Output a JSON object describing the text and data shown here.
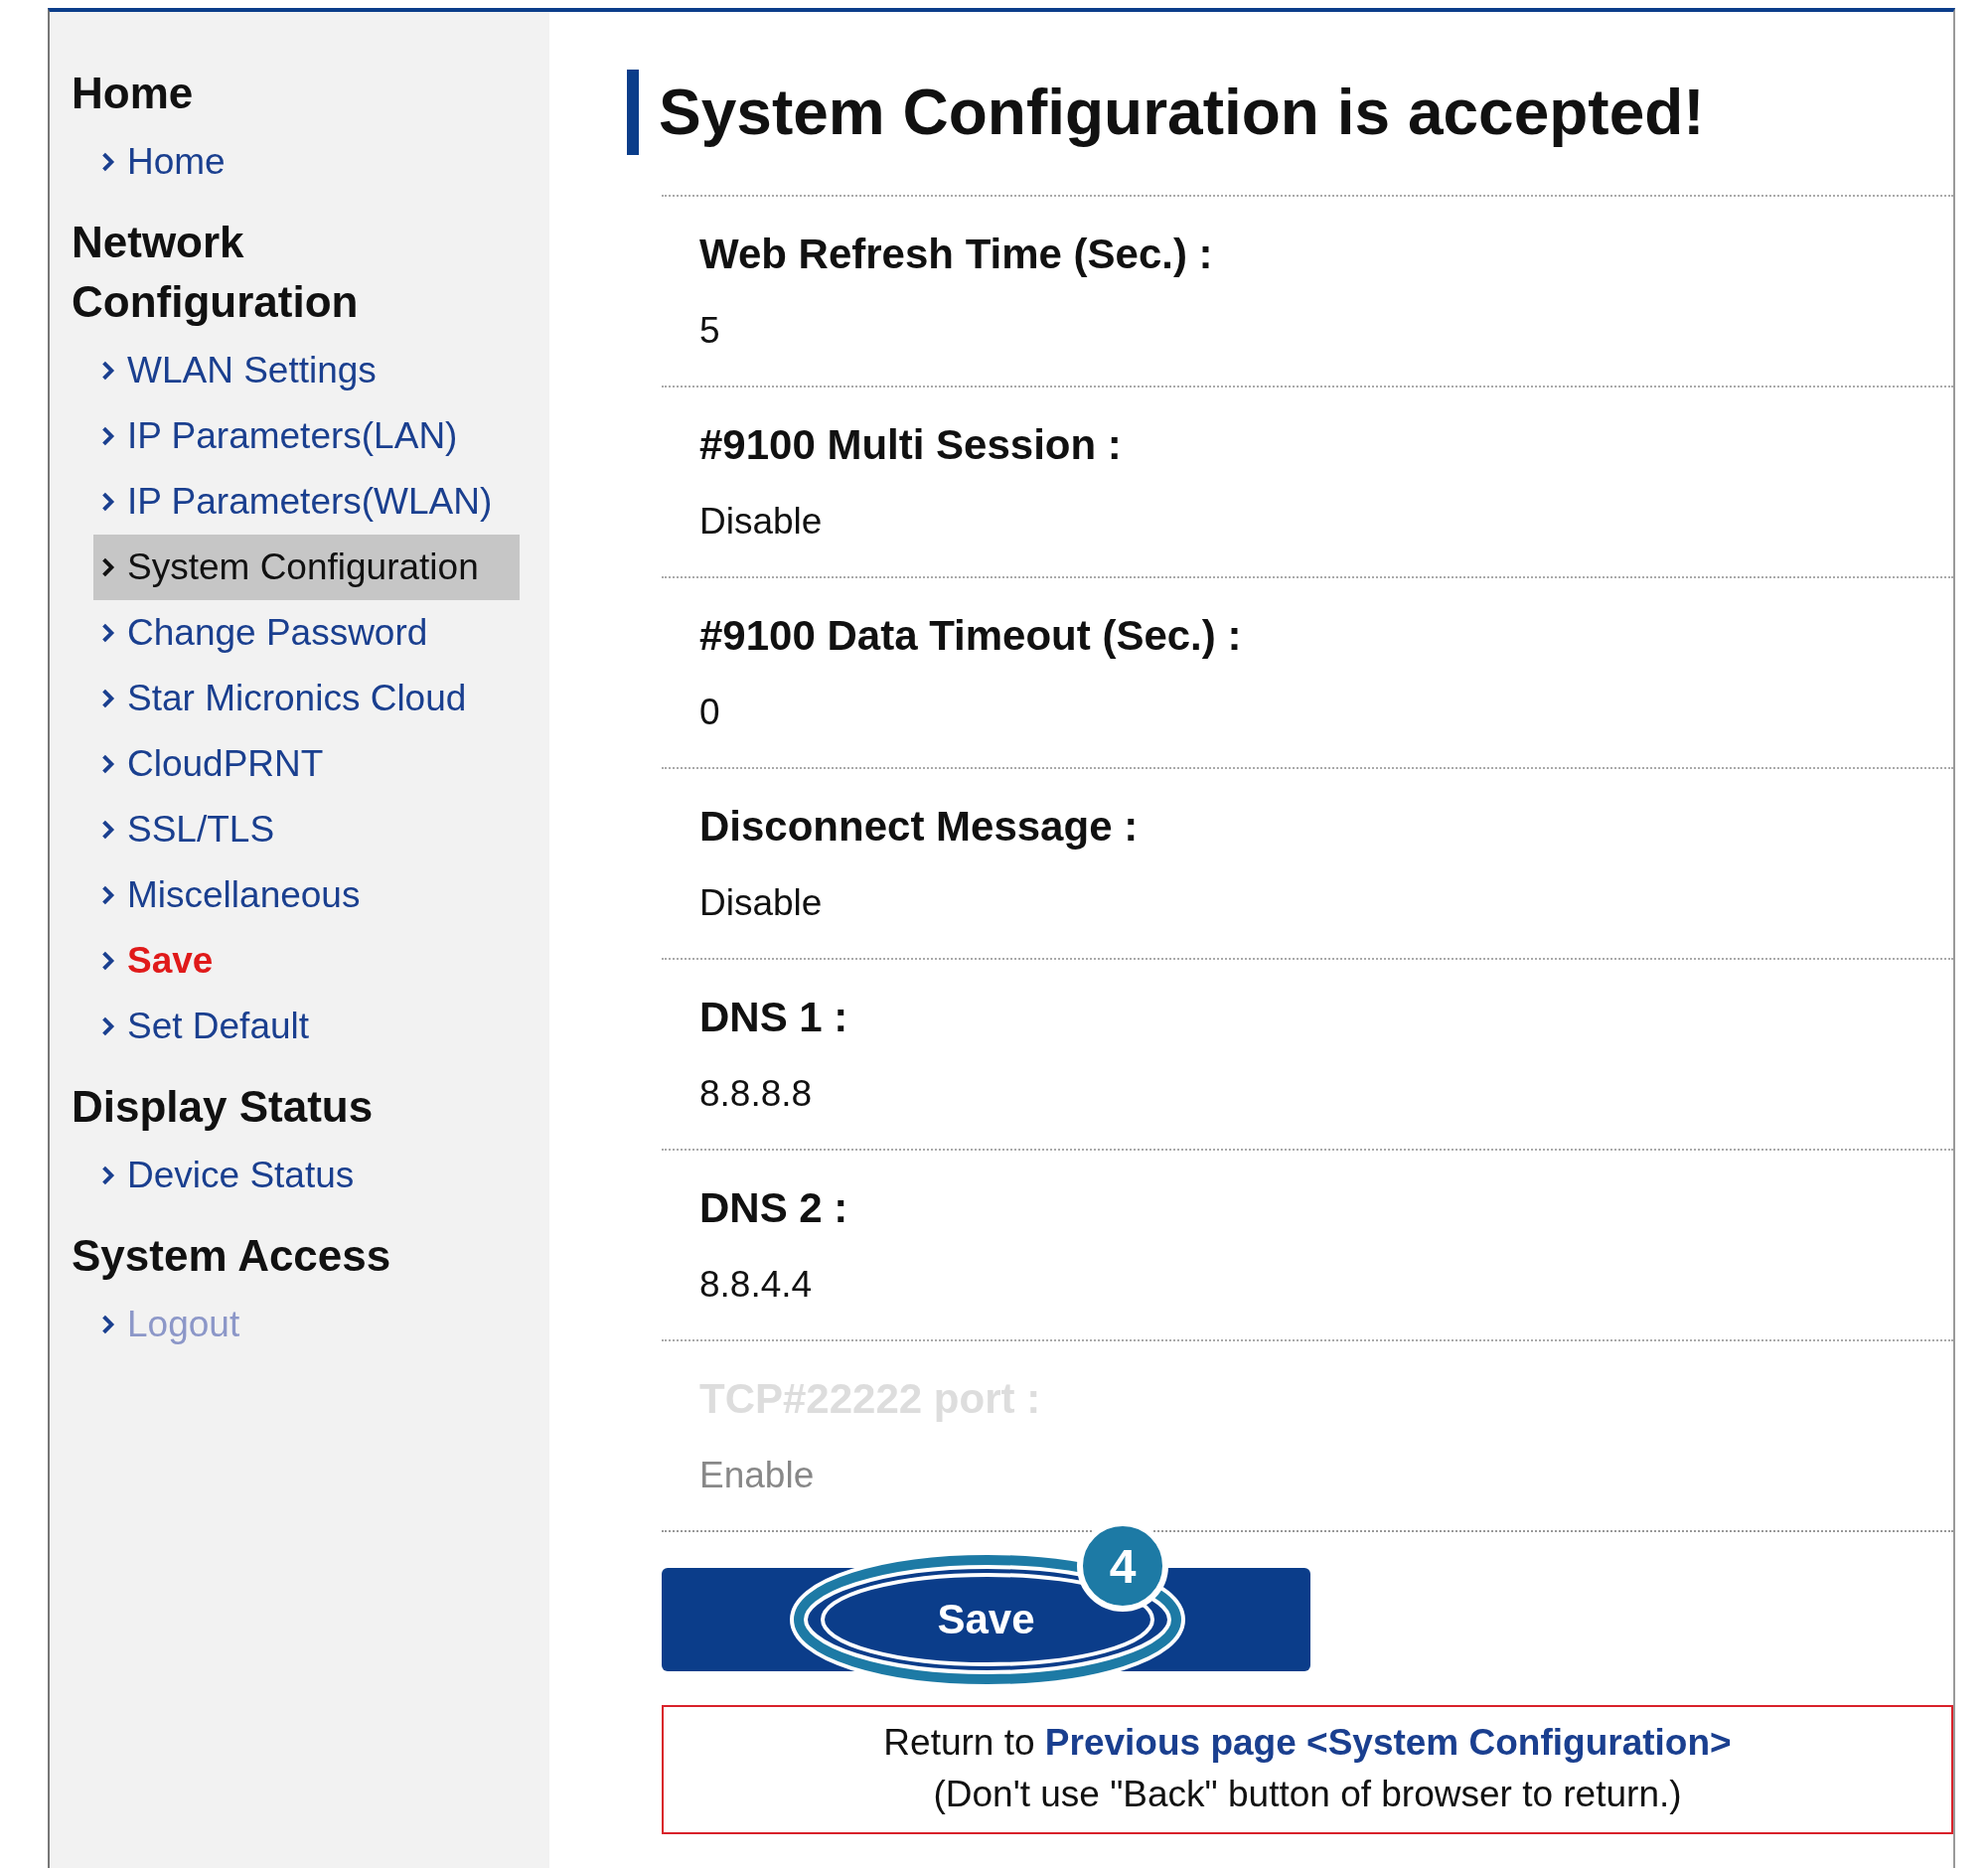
{
  "sidebar": {
    "sections": [
      {
        "heading": "Home",
        "items": [
          {
            "label": "Home",
            "selected": false,
            "alert": false,
            "faded": false
          }
        ]
      },
      {
        "heading": "Network Configuration",
        "items": [
          {
            "label": "WLAN Settings",
            "selected": false,
            "alert": false,
            "faded": false
          },
          {
            "label": "IP Parameters(LAN)",
            "selected": false,
            "alert": false,
            "faded": false
          },
          {
            "label": "IP Parameters(WLAN)",
            "selected": false,
            "alert": false,
            "faded": false
          },
          {
            "label": "System Configuration",
            "selected": true,
            "alert": false,
            "faded": false
          },
          {
            "label": "Change Password",
            "selected": false,
            "alert": false,
            "faded": false
          },
          {
            "label": "Star Micronics Cloud",
            "selected": false,
            "alert": false,
            "faded": false
          },
          {
            "label": "CloudPRNT",
            "selected": false,
            "alert": false,
            "faded": false
          },
          {
            "label": "SSL/TLS",
            "selected": false,
            "alert": false,
            "faded": false
          },
          {
            "label": "Miscellaneous",
            "selected": false,
            "alert": false,
            "faded": false
          },
          {
            "label": "Save",
            "selected": false,
            "alert": true,
            "faded": false
          },
          {
            "label": "Set Default",
            "selected": false,
            "alert": false,
            "faded": false
          }
        ]
      },
      {
        "heading": "Display Status",
        "items": [
          {
            "label": "Device Status",
            "selected": false,
            "alert": false,
            "faded": false
          }
        ]
      },
      {
        "heading": "System Access",
        "items": [
          {
            "label": "Logout",
            "selected": false,
            "alert": false,
            "faded": true
          }
        ]
      }
    ]
  },
  "title": "System Configuration is accepted!",
  "settings": [
    {
      "label": "Web Refresh Time (Sec.) :",
      "value": "5",
      "faded": false
    },
    {
      "label": "#9100 Multi Session :",
      "value": "Disable",
      "faded": false
    },
    {
      "label": "#9100 Data Timeout (Sec.) :",
      "value": "0",
      "faded": false
    },
    {
      "label": "Disconnect Message :",
      "value": "Disable",
      "faded": false
    },
    {
      "label": "DNS 1 :",
      "value": "8.8.8.8",
      "faded": false
    },
    {
      "label": "DNS 2 :",
      "value": "8.8.4.4",
      "faded": false
    },
    {
      "label": "TCP#22222 port :",
      "value": "Enable",
      "faded": true
    }
  ],
  "save_button": {
    "label": "Save"
  },
  "callout": {
    "number": "4"
  },
  "return_note": {
    "prefix": "Return to",
    "link": "Previous page <System Configuration>",
    "warning": "(Don't use \"Back\" button of browser to return.)"
  }
}
